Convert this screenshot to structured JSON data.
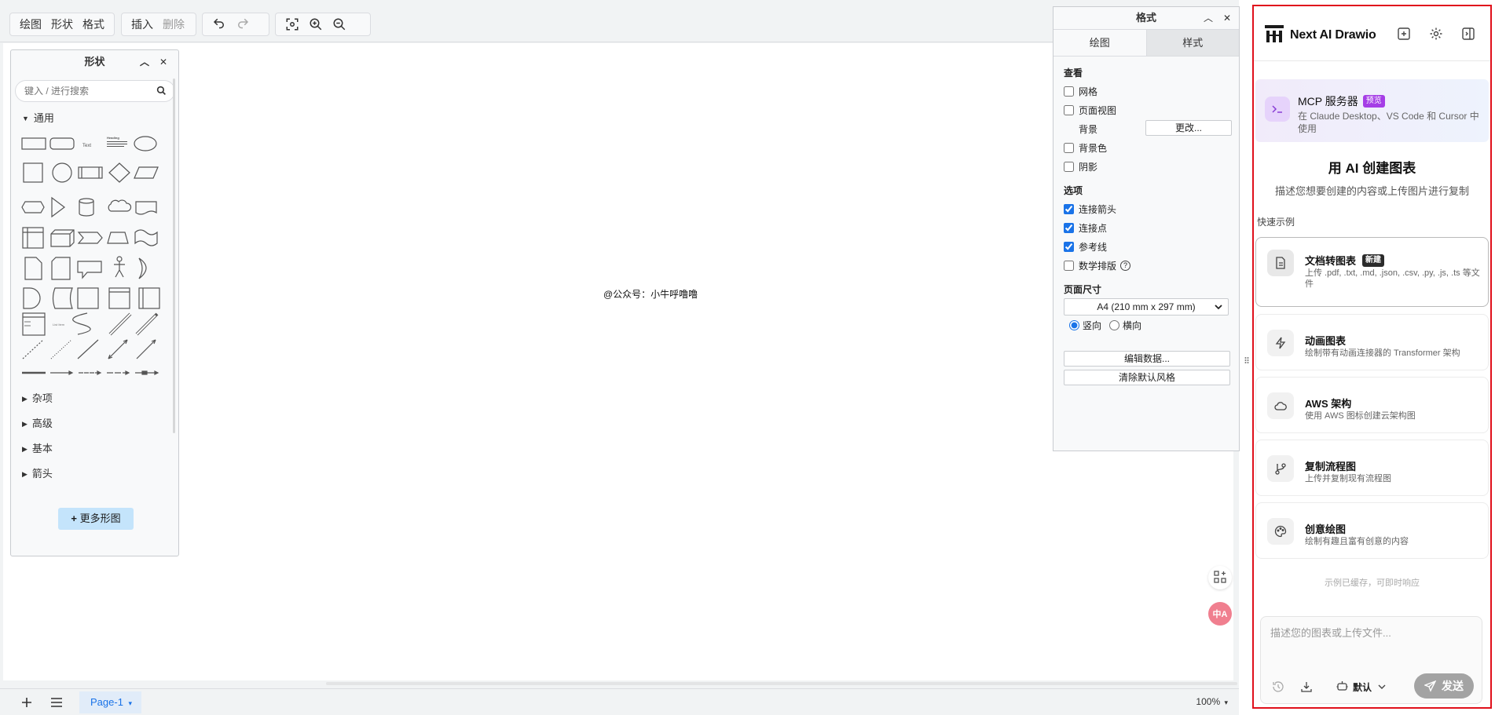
{
  "toolbar": {
    "draw": "绘图",
    "shapes": "形状",
    "format": "格式",
    "insert": "插入",
    "delete": "删除"
  },
  "canvas": {
    "watermark": "@公众号：小牛呼噜噜"
  },
  "shapes_panel": {
    "title": "形状",
    "search_placeholder": "键入 / 进行搜索",
    "general": "通用",
    "categories": [
      "杂项",
      "高级",
      "基本",
      "箭头"
    ],
    "more_shapes": "更多形图",
    "text_shape": "Text",
    "heading_shape": "Heading",
    "list_item": "List Item"
  },
  "format_panel": {
    "title": "格式",
    "tab_draw": "绘图",
    "tab_style": "样式",
    "view_section": "查看",
    "grid": "网格",
    "page_view": "页面视图",
    "background": "背景",
    "change_btn": "更改...",
    "bg_color": "背景色",
    "shadow": "阴影",
    "options_section": "选项",
    "connect_arrows": "连接箭头",
    "connect_points": "连接点",
    "guides": "参考线",
    "math_typesetting": "数学排版",
    "page_size_section": "页面尺寸",
    "page_size": "A4 (210 mm x 297 mm)",
    "portrait": "竖向",
    "landscape": "横向",
    "edit_data": "编辑数据...",
    "clear_style": "清除默认风格"
  },
  "bottombar": {
    "page_tab": "Page-1",
    "zoom": "100%"
  },
  "chat": {
    "brand": "Next AI Drawio",
    "mcp_title": "MCP 服务器",
    "mcp_badge": "预览",
    "mcp_desc": "在 Claude Desktop、VS Code 和 Cursor 中使用",
    "hero_title": "用 AI 创建图表",
    "hero_sub": "描述您想要创建的内容或上传图片进行复制",
    "quick_label": "快速示例",
    "examples": [
      {
        "title": "文档转图表",
        "badge": "新建",
        "desc": "上传 .pdf, .txt, .md, .json, .csv, .py, .js, .ts 等文件"
      },
      {
        "title": "动画图表",
        "desc": "绘制带有动画连接器的 Transformer 架构"
      },
      {
        "title": "AWS 架构",
        "desc": "使用 AWS 图标创建云架构图"
      },
      {
        "title": "复制流程图",
        "desc": "上传并复制现有流程图"
      },
      {
        "title": "创意绘图",
        "desc": "绘制有趣且富有创意的内容"
      }
    ],
    "cache_note": "示例已缓存，可即时响应",
    "input_placeholder": "描述您的图表或上传文件...",
    "model": "默认",
    "send": "发送"
  },
  "colors": {
    "accent_blue": "#1a73e8",
    "highlight_red": "#e0101b",
    "mcp_badge": "#a53ee6",
    "new_badge": "#2b2b2b"
  }
}
